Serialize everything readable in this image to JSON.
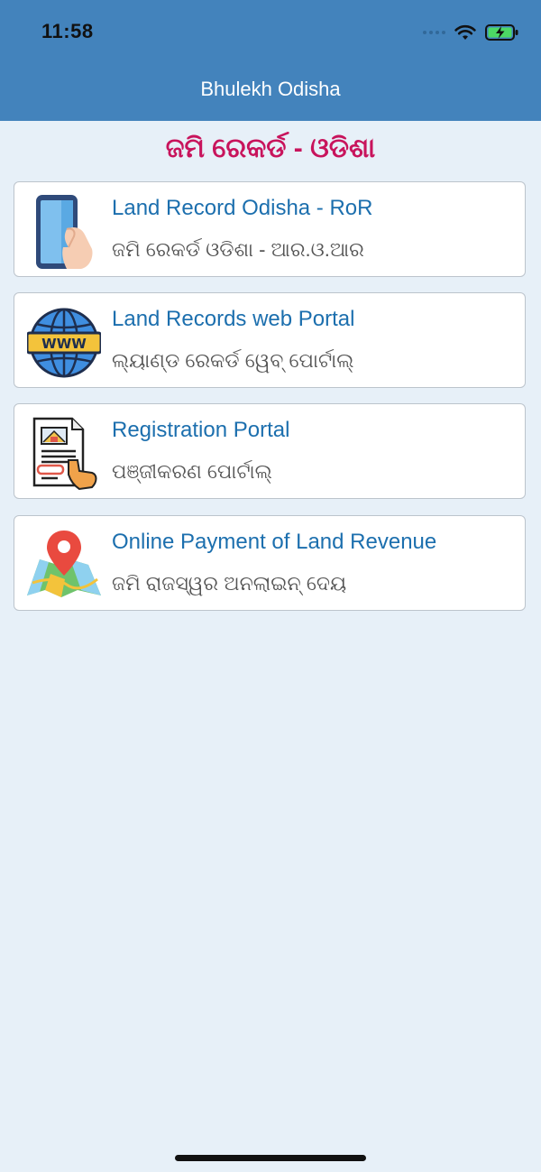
{
  "status_bar": {
    "time": "11:58"
  },
  "header": {
    "title": "Bhulekh Odisha"
  },
  "section": {
    "title": "ଜମି ରେକର୍ଡ - ଓଡିଶା"
  },
  "items": [
    {
      "title": "Land Record Odisha - RoR",
      "subtitle": "ଜମି ରେକର୍ଡ ଓଡିଶା - ଆର.ଓ.ଆର",
      "icon": "phone-hand-icon"
    },
    {
      "title": "Land Records web Portal",
      "subtitle": "ଲ୍ୟାଣ୍ଡ ରେକର୍ଡ ୱେବ୍ ପୋର୍ଟାଲ୍",
      "icon": "www-globe-icon",
      "icon_label": "WWW"
    },
    {
      "title": "Registration Portal",
      "subtitle": "ପଞ୍ଜୀକରଣ ପୋର୍ଟାଲ୍",
      "icon": "registration-document-icon"
    },
    {
      "title": "Online Payment of Land Revenue",
      "subtitle": "ଜମି ରାଜସ୍ୱର ଅନଲାଇନ୍ ଦେୟ",
      "icon": "map-pin-icon"
    }
  ],
  "colors": {
    "header": "#4383bc",
    "background": "#e7f0f8",
    "section_title": "#c8145c",
    "item_title": "#1c6fae"
  }
}
